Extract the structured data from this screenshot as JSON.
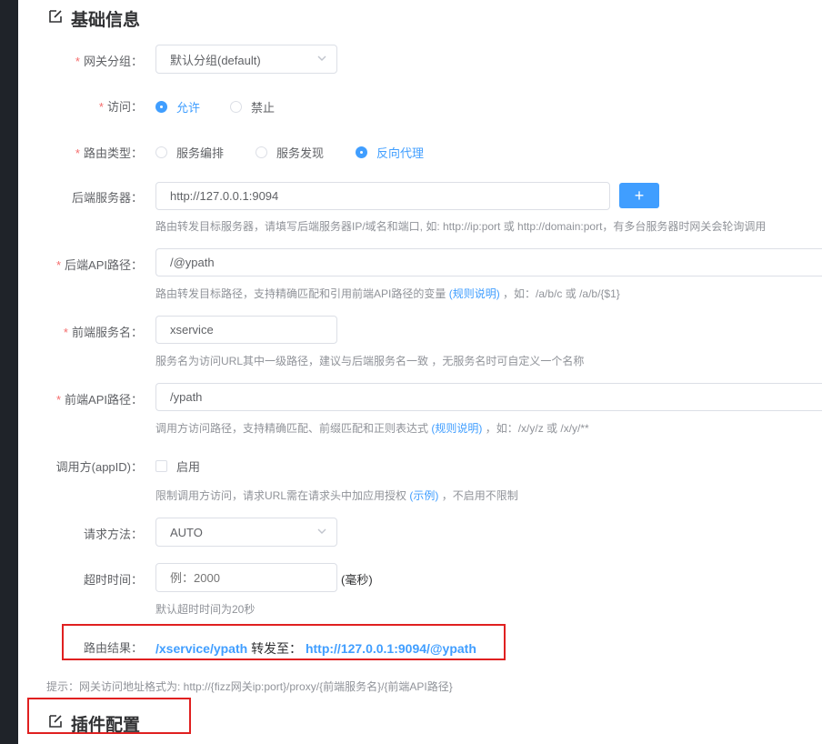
{
  "basic_section": {
    "title": "基础信息",
    "icon": "edit-icon"
  },
  "plugin_section": {
    "title": "插件配置",
    "icon": "edit-icon"
  },
  "gateway_group": {
    "label": "网关分组：",
    "value": "默认分组(default)"
  },
  "access": {
    "label": "访问：",
    "options": [
      "允许",
      "禁止"
    ],
    "selected": "允许"
  },
  "route_type": {
    "label": "路由类型：",
    "options": [
      "服务编排",
      "服务发现",
      "反向代理"
    ],
    "selected": "反向代理"
  },
  "backend_server": {
    "label": "后端服务器：",
    "value": "http://127.0.0.1:9094",
    "add_label": "+",
    "hint": "路由转发目标服务器，请填写后端服务器IP/域名和端口, 如: http://ip:port 或 http://domain:port，有多台服务器时网关会轮询调用"
  },
  "backend_api_path": {
    "label": "后端API路径：",
    "value": "/@ypath",
    "hint_before": "路由转发目标路径，支持精确匹配和引用前端API路径的变量",
    "hint_link": "(规则说明)",
    "hint_after": "，如：/a/b/c 或 /a/b/{$1}"
  },
  "frontend_service": {
    "label": "前端服务名：",
    "value": "xservice",
    "hint": "服务名为访问URL其中一级路径，建议与后端服务名一致 ，无服务名时可自定义一个名称"
  },
  "frontend_api_path": {
    "label": "前端API路径：",
    "value": "/ypath",
    "hint_before": "调用方访问路径，支持精确匹配、前缀匹配和正则表达式",
    "hint_link": "(规则说明)",
    "hint_after": "，如：/x/y/z 或 /x/y/**"
  },
  "caller": {
    "label": "调用方(appID)：",
    "checkbox_label": "启用",
    "checked": false,
    "hint_before": "限制调用方访问，请求URL需在请求头中加应用授权",
    "hint_link": "(示例)",
    "hint_after": "，不启用不限制"
  },
  "request_method": {
    "label": "请求方法：",
    "value": "AUTO"
  },
  "timeout": {
    "label": "超时时间：",
    "placeholder": "例：2000",
    "unit": "(毫秒)",
    "hint": "默认超时时间为20秒"
  },
  "route_result": {
    "label": "路由结果：",
    "from": "/xservice/ypath",
    "middle": "转发至：",
    "to": "http://127.0.0.1:9094/@ypath"
  },
  "tip": "提示：网关访问地址格式为: http://{fizz网关ip:port}/proxy/{前端服务名}/{前端API路径}",
  "colors": {
    "primary": "#409eff",
    "required": "#f56c6c",
    "highlight_box": "#e02020"
  }
}
